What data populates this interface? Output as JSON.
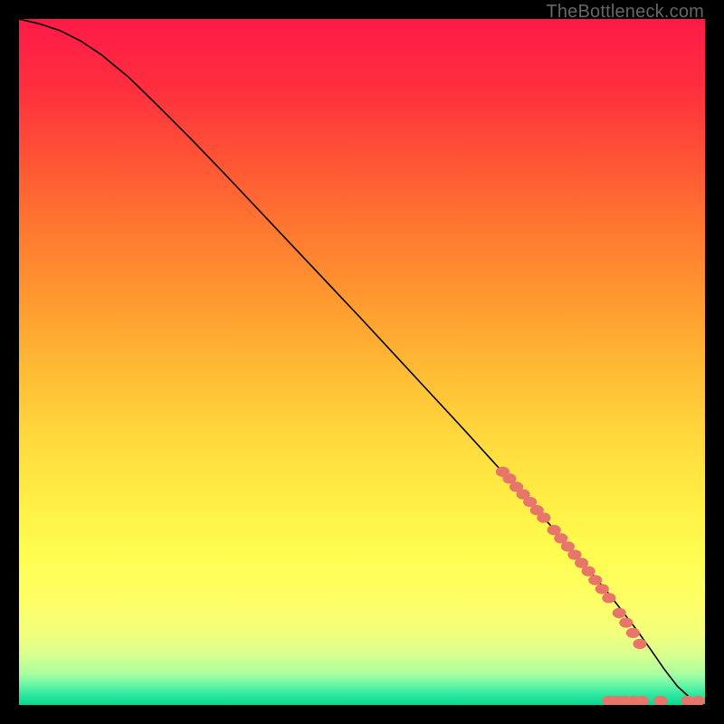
{
  "watermark": "TheBottleneck.com",
  "chart_data": {
    "type": "line",
    "title": "",
    "xlabel": "",
    "ylabel": "",
    "xlim": [
      0,
      100
    ],
    "ylim": [
      0,
      100
    ],
    "grid": false,
    "gradient_stops": [
      {
        "offset": 0.0,
        "color": "#ff1a48"
      },
      {
        "offset": 0.1,
        "color": "#ff2f3e"
      },
      {
        "offset": 0.2,
        "color": "#ff5236"
      },
      {
        "offset": 0.3,
        "color": "#ff7630"
      },
      {
        "offset": 0.4,
        "color": "#ff9630"
      },
      {
        "offset": 0.5,
        "color": "#ffb734"
      },
      {
        "offset": 0.6,
        "color": "#ffd63c"
      },
      {
        "offset": 0.7,
        "color": "#ffee44"
      },
      {
        "offset": 0.78,
        "color": "#fffc50"
      },
      {
        "offset": 0.85,
        "color": "#feff66"
      },
      {
        "offset": 0.9,
        "color": "#f0ff7e"
      },
      {
        "offset": 0.93,
        "color": "#d4ff90"
      },
      {
        "offset": 0.955,
        "color": "#a8ffa0"
      },
      {
        "offset": 0.97,
        "color": "#6cf6a8"
      },
      {
        "offset": 0.985,
        "color": "#2de8a0"
      },
      {
        "offset": 1.0,
        "color": "#08d890"
      }
    ],
    "series": [
      {
        "name": "curve",
        "color": "#000000",
        "x": [
          0,
          3,
          6,
          9,
          12,
          16,
          20,
          25,
          30,
          35,
          40,
          45,
          50,
          55,
          60,
          65,
          70,
          75,
          80,
          83,
          86,
          88,
          90,
          92,
          94,
          96,
          98,
          100
        ],
        "y": [
          100,
          99.3,
          98.3,
          96.8,
          94.8,
          91.5,
          87.6,
          82.6,
          77.4,
          72.1,
          66.8,
          61.5,
          56.2,
          50.8,
          45.4,
          40.0,
          34.5,
          29.0,
          23.3,
          19.8,
          16.2,
          13.6,
          11.0,
          8.2,
          5.3,
          2.7,
          0.9,
          0.0
        ]
      }
    ],
    "scatter": {
      "name": "dots",
      "color": "#e8756a",
      "radius_x": 1.0,
      "radius_y": 0.75,
      "points": [
        {
          "x": 70.5,
          "y": 34.0
        },
        {
          "x": 71.5,
          "y": 33.0
        },
        {
          "x": 72.5,
          "y": 31.8
        },
        {
          "x": 73.5,
          "y": 30.7
        },
        {
          "x": 74.5,
          "y": 29.6
        },
        {
          "x": 75.5,
          "y": 28.4
        },
        {
          "x": 76.5,
          "y": 27.3
        },
        {
          "x": 78.0,
          "y": 25.5
        },
        {
          "x": 79.0,
          "y": 24.3
        },
        {
          "x": 80.0,
          "y": 23.1
        },
        {
          "x": 81.0,
          "y": 21.9
        },
        {
          "x": 82.0,
          "y": 20.7
        },
        {
          "x": 83.0,
          "y": 19.5
        },
        {
          "x": 84.0,
          "y": 18.2
        },
        {
          "x": 85.0,
          "y": 16.9
        },
        {
          "x": 86.0,
          "y": 15.6
        },
        {
          "x": 87.5,
          "y": 13.4
        },
        {
          "x": 88.5,
          "y": 12.0
        },
        {
          "x": 89.5,
          "y": 10.5
        },
        {
          "x": 90.5,
          "y": 8.9
        },
        {
          "x": 86.0,
          "y": 0.6
        },
        {
          "x": 87.2,
          "y": 0.6
        },
        {
          "x": 88.4,
          "y": 0.6
        },
        {
          "x": 89.6,
          "y": 0.6
        },
        {
          "x": 90.8,
          "y": 0.6
        },
        {
          "x": 93.5,
          "y": 0.6
        },
        {
          "x": 97.5,
          "y": 0.6
        },
        {
          "x": 99.0,
          "y": 0.6
        }
      ]
    }
  }
}
